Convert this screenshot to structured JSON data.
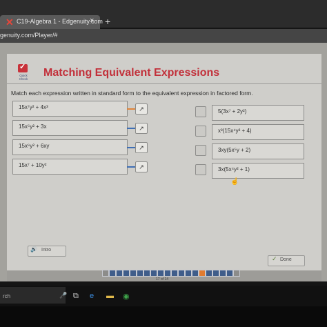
{
  "browser": {
    "tab_title": "C19-Algebra 1 - Edgenuity.com",
    "tab_close": "×",
    "new_tab": "+",
    "url": "genuity.com/Player/#"
  },
  "header": {
    "quick_check_label": "Quick Check",
    "title": "Matching Equivalent Expressions"
  },
  "instructions": "Match each expression written in standard form to the equivalent expression in factored form.",
  "left_expressions": [
    "15x⁷y² + 4x³",
    "15x⁵y² + 3x",
    "15x⁶y² + 6xy",
    "15x⁷ + 10y²"
  ],
  "right_expressions": [
    "5(3x⁷ + 2y²)",
    "x³(15x⁴y² + 4)",
    "3xy(5x⁵y + 2)",
    "3x(5x⁴y² + 1)"
  ],
  "connector_colors": [
    "#e0843a",
    "#3f6fb5",
    "#3f6fb5",
    "#3f6fb5"
  ],
  "arrow_glyph": "↗",
  "buttons": {
    "intro_label": "Intro",
    "done_label": "Done"
  },
  "pager": {
    "label": "17 of 14"
  },
  "taskbar": {
    "search_text": "rch"
  },
  "colors": {
    "brand_red": "#c2303a",
    "pager_blue": "#3f5d8a",
    "pager_current": "#e07b30"
  }
}
